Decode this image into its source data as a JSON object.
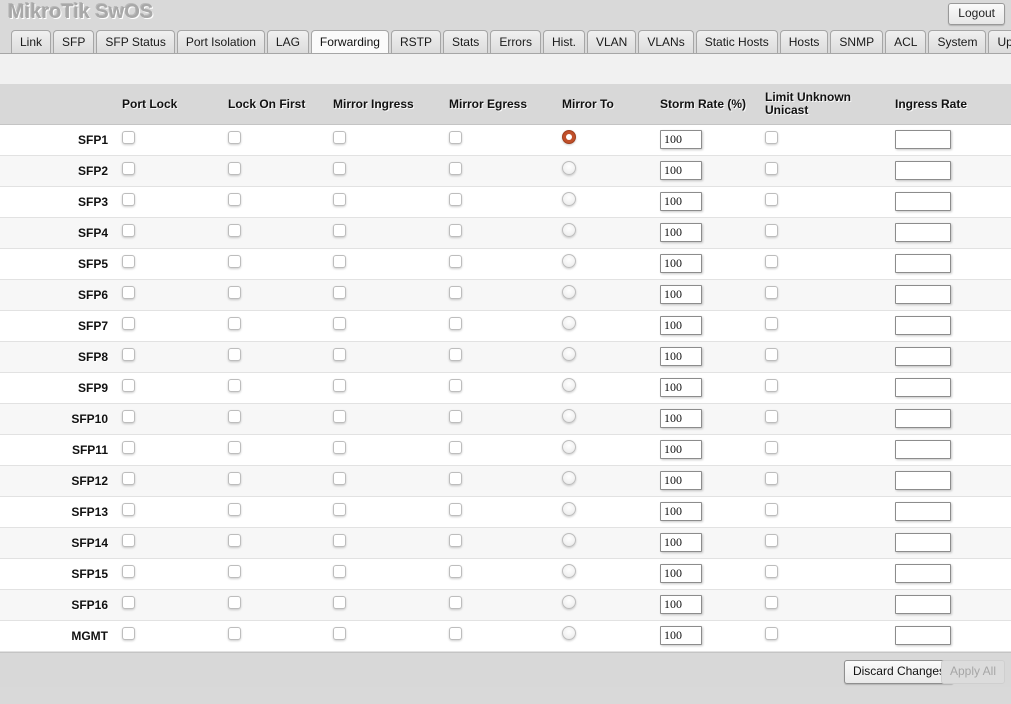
{
  "header": {
    "brand": "MikroTik SwOS",
    "logout_label": "Logout"
  },
  "tabs": [
    {
      "label": "Link",
      "active": false
    },
    {
      "label": "SFP",
      "active": false
    },
    {
      "label": "SFP Status",
      "active": false
    },
    {
      "label": "Port Isolation",
      "active": false
    },
    {
      "label": "LAG",
      "active": false
    },
    {
      "label": "Forwarding",
      "active": true
    },
    {
      "label": "RSTP",
      "active": false
    },
    {
      "label": "Stats",
      "active": false
    },
    {
      "label": "Errors",
      "active": false
    },
    {
      "label": "Hist.",
      "active": false
    },
    {
      "label": "VLAN",
      "active": false
    },
    {
      "label": "VLANs",
      "active": false
    },
    {
      "label": "Static Hosts",
      "active": false
    },
    {
      "label": "Hosts",
      "active": false
    },
    {
      "label": "SNMP",
      "active": false
    },
    {
      "label": "ACL",
      "active": false
    },
    {
      "label": "System",
      "active": false
    },
    {
      "label": "Upgrade",
      "active": false
    }
  ],
  "table": {
    "columns": [
      {
        "key": "port",
        "label": ""
      },
      {
        "key": "port_lock",
        "label": "Port Lock"
      },
      {
        "key": "lock_first",
        "label": "Lock On First"
      },
      {
        "key": "mirror_in",
        "label": "Mirror Ingress"
      },
      {
        "key": "mirror_eg",
        "label": "Mirror Egress"
      },
      {
        "key": "mirror_to",
        "label": "Mirror To"
      },
      {
        "key": "storm_rate",
        "label": "Storm Rate (%)"
      },
      {
        "key": "limit_unk",
        "label": "Limit Unknown Unicast"
      },
      {
        "key": "ingress",
        "label": "Ingress Rate"
      }
    ],
    "limit_unknown_line1": "Limit Unknown",
    "limit_unknown_line2": "Unicast",
    "rows": [
      {
        "port": "SFP1",
        "port_lock": false,
        "lock_first": false,
        "mirror_in": false,
        "mirror_eg": false,
        "mirror_to": true,
        "storm_rate": "100",
        "limit_unk": false,
        "ingress": ""
      },
      {
        "port": "SFP2",
        "port_lock": false,
        "lock_first": false,
        "mirror_in": false,
        "mirror_eg": false,
        "mirror_to": false,
        "storm_rate": "100",
        "limit_unk": false,
        "ingress": ""
      },
      {
        "port": "SFP3",
        "port_lock": false,
        "lock_first": false,
        "mirror_in": false,
        "mirror_eg": false,
        "mirror_to": false,
        "storm_rate": "100",
        "limit_unk": false,
        "ingress": ""
      },
      {
        "port": "SFP4",
        "port_lock": false,
        "lock_first": false,
        "mirror_in": false,
        "mirror_eg": false,
        "mirror_to": false,
        "storm_rate": "100",
        "limit_unk": false,
        "ingress": ""
      },
      {
        "port": "SFP5",
        "port_lock": false,
        "lock_first": false,
        "mirror_in": false,
        "mirror_eg": false,
        "mirror_to": false,
        "storm_rate": "100",
        "limit_unk": false,
        "ingress": ""
      },
      {
        "port": "SFP6",
        "port_lock": false,
        "lock_first": false,
        "mirror_in": false,
        "mirror_eg": false,
        "mirror_to": false,
        "storm_rate": "100",
        "limit_unk": false,
        "ingress": ""
      },
      {
        "port": "SFP7",
        "port_lock": false,
        "lock_first": false,
        "mirror_in": false,
        "mirror_eg": false,
        "mirror_to": false,
        "storm_rate": "100",
        "limit_unk": false,
        "ingress": ""
      },
      {
        "port": "SFP8",
        "port_lock": false,
        "lock_first": false,
        "mirror_in": false,
        "mirror_eg": false,
        "mirror_to": false,
        "storm_rate": "100",
        "limit_unk": false,
        "ingress": ""
      },
      {
        "port": "SFP9",
        "port_lock": false,
        "lock_first": false,
        "mirror_in": false,
        "mirror_eg": false,
        "mirror_to": false,
        "storm_rate": "100",
        "limit_unk": false,
        "ingress": ""
      },
      {
        "port": "SFP10",
        "port_lock": false,
        "lock_first": false,
        "mirror_in": false,
        "mirror_eg": false,
        "mirror_to": false,
        "storm_rate": "100",
        "limit_unk": false,
        "ingress": ""
      },
      {
        "port": "SFP11",
        "port_lock": false,
        "lock_first": false,
        "mirror_in": false,
        "mirror_eg": false,
        "mirror_to": false,
        "storm_rate": "100",
        "limit_unk": false,
        "ingress": ""
      },
      {
        "port": "SFP12",
        "port_lock": false,
        "lock_first": false,
        "mirror_in": false,
        "mirror_eg": false,
        "mirror_to": false,
        "storm_rate": "100",
        "limit_unk": false,
        "ingress": ""
      },
      {
        "port": "SFP13",
        "port_lock": false,
        "lock_first": false,
        "mirror_in": false,
        "mirror_eg": false,
        "mirror_to": false,
        "storm_rate": "100",
        "limit_unk": false,
        "ingress": ""
      },
      {
        "port": "SFP14",
        "port_lock": false,
        "lock_first": false,
        "mirror_in": false,
        "mirror_eg": false,
        "mirror_to": false,
        "storm_rate": "100",
        "limit_unk": false,
        "ingress": ""
      },
      {
        "port": "SFP15",
        "port_lock": false,
        "lock_first": false,
        "mirror_in": false,
        "mirror_eg": false,
        "mirror_to": false,
        "storm_rate": "100",
        "limit_unk": false,
        "ingress": ""
      },
      {
        "port": "SFP16",
        "port_lock": false,
        "lock_first": false,
        "mirror_in": false,
        "mirror_eg": false,
        "mirror_to": false,
        "storm_rate": "100",
        "limit_unk": false,
        "ingress": ""
      },
      {
        "port": "MGMT",
        "port_lock": false,
        "lock_first": false,
        "mirror_in": false,
        "mirror_eg": false,
        "mirror_to": false,
        "storm_rate": "100",
        "limit_unk": false,
        "ingress": ""
      }
    ]
  },
  "footer": {
    "discard_label": "Discard Changes",
    "apply_label": "Apply All",
    "apply_enabled": false
  },
  "colors": {
    "accent_selected_radio": "#c1502a",
    "header_row_bg": "#d8d8d8",
    "page_bg": "#d9d9d9",
    "row_alt_bg": "#f7f7f7"
  }
}
